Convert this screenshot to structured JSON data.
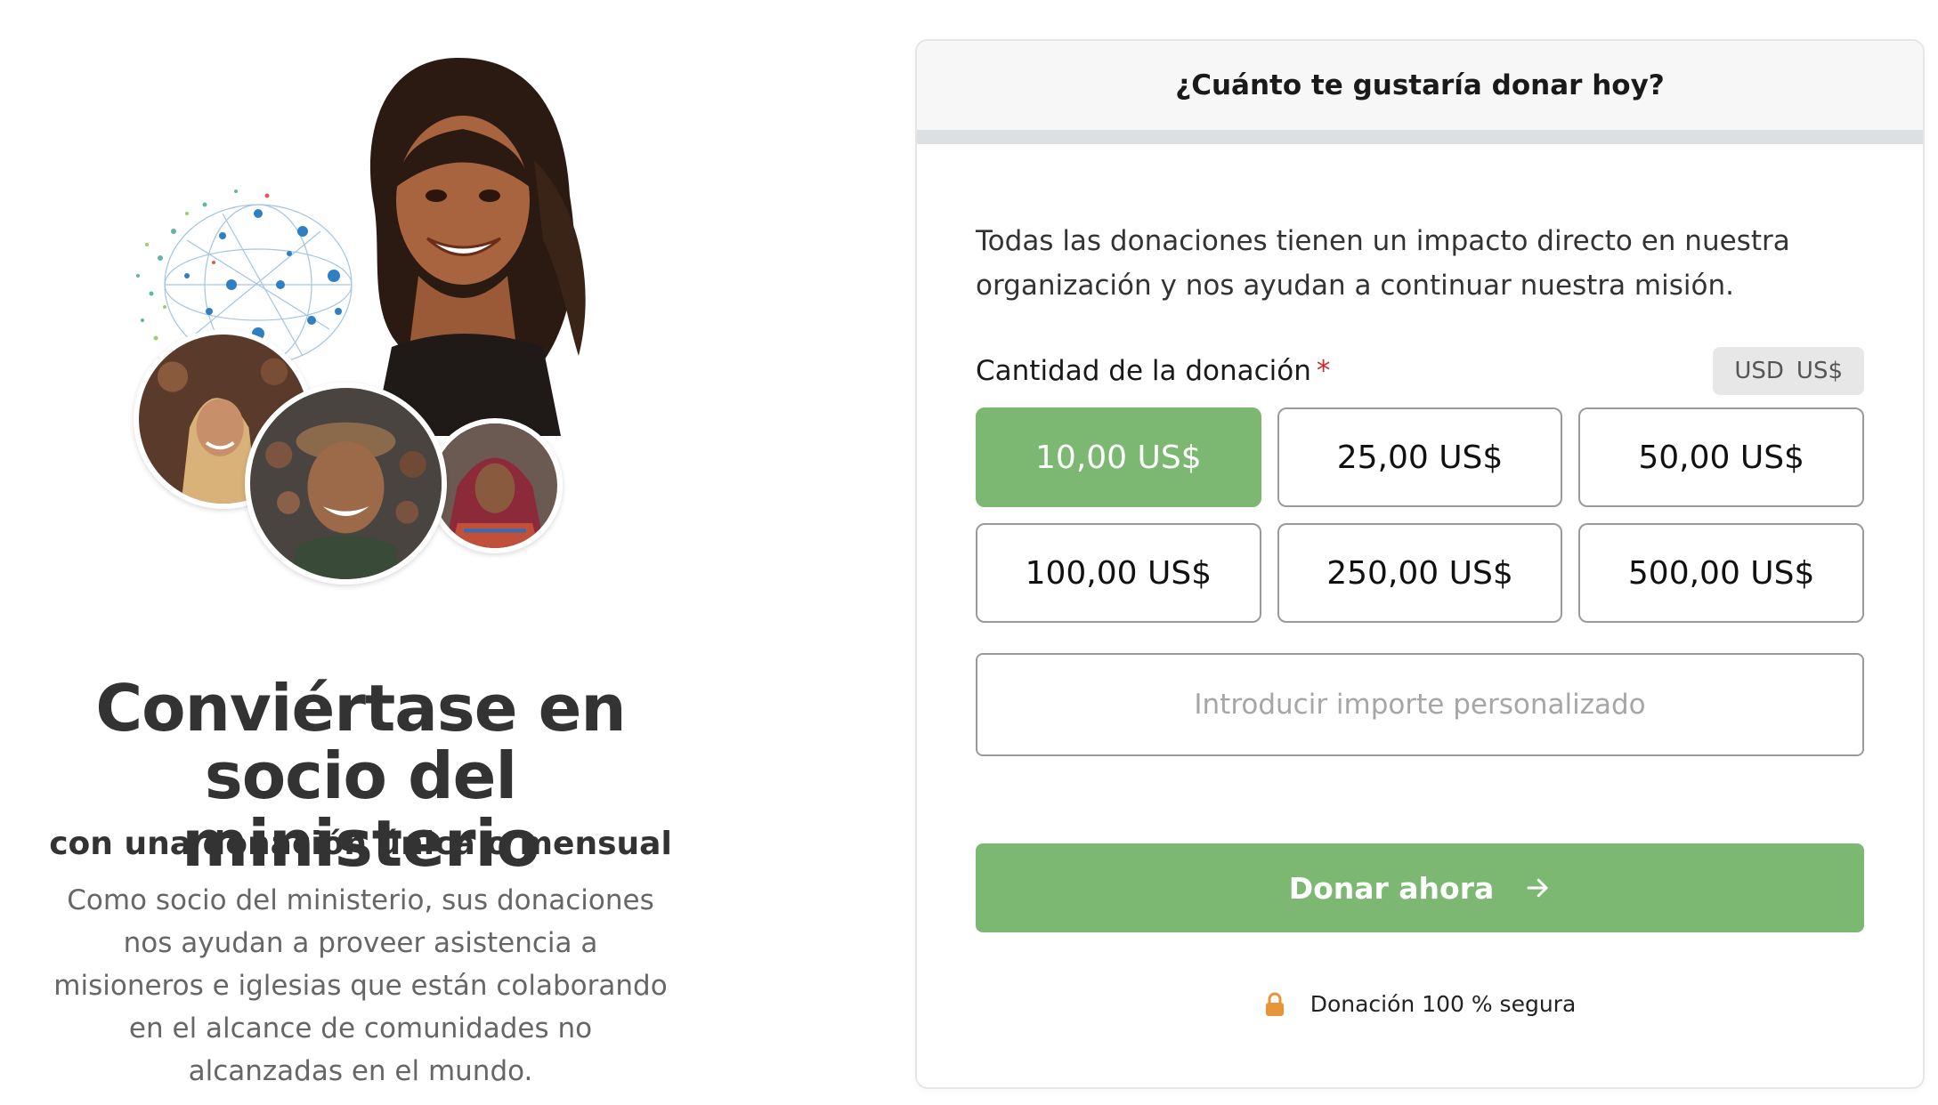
{
  "hero": {
    "title_line1": "Conviértase en",
    "title_line2": "socio del ministerio",
    "subtitle": "con una donación única o mensual",
    "body": "Como socio del ministerio, sus donaciones nos ayudan a proveer asistencia a misioneros e iglesias que están colaborando en el alcance de comunidades no alcanzadas en el mundo."
  },
  "card": {
    "header": "¿Cuánto te gustaría donar hoy?",
    "intro": "Todas las donaciones tienen un impacto directo en nuestra organización y nos ayudan a continuar nuestra misión.",
    "amount_label": "Cantidad de la donación",
    "required_mark": "*",
    "currency": {
      "code": "USD",
      "symbol": "US$"
    },
    "amounts": [
      {
        "label": "10,00 US$",
        "selected": true
      },
      {
        "label": "25,00 US$",
        "selected": false
      },
      {
        "label": "50,00 US$",
        "selected": false
      },
      {
        "label": "100,00 US$",
        "selected": false
      },
      {
        "label": "250,00 US$",
        "selected": false
      },
      {
        "label": "500,00 US$",
        "selected": false
      }
    ],
    "custom_amount": {
      "value": "",
      "placeholder": "Introducir importe personalizado"
    },
    "donate_label": "Donar ahora",
    "donate_icon": "arrow-right-icon",
    "secure_label": "Donación 100 % segura",
    "secure_icon": "lock-icon"
  },
  "colors": {
    "accent_green": "#7cb872",
    "lock_orange": "#e8953a",
    "required_red": "#cc2a2a"
  }
}
